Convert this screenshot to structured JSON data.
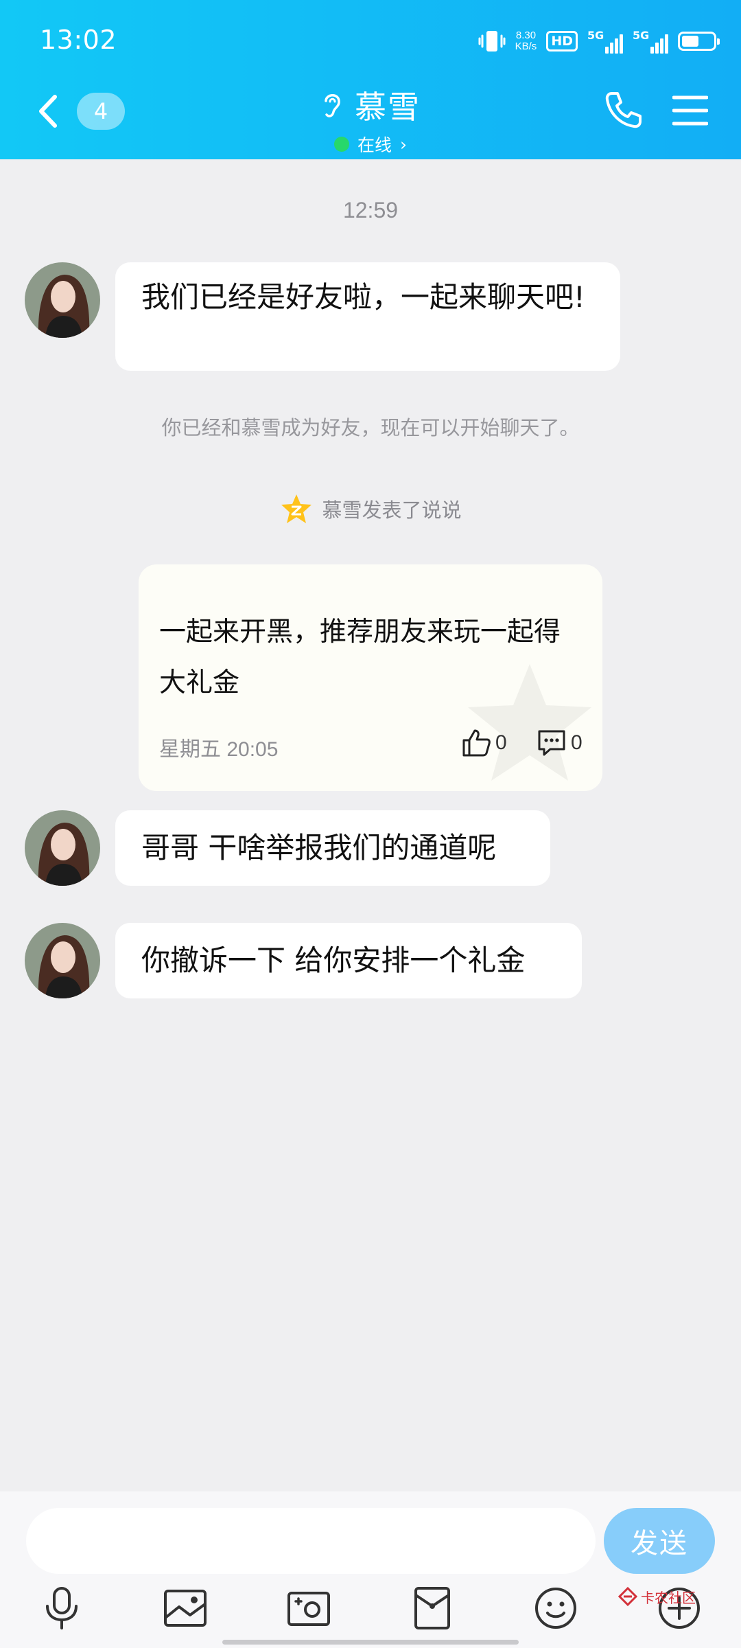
{
  "status_bar": {
    "time": "13:02",
    "speed_value": "8.30",
    "speed_unit": "KB/s",
    "hd_label": "HD",
    "sim1_net": "5G",
    "sim2_net": "5G",
    "battery_level": 0.55
  },
  "header": {
    "unread_count": "4",
    "contact_name": "慕雪",
    "status": "在线",
    "status_arrow": "›"
  },
  "chat": {
    "timestamp": "12:59",
    "messages": [
      {
        "type": "incoming",
        "text": "我们已经是好友啦，一起来聊天吧!"
      },
      {
        "type": "system",
        "text": "你已经和慕雪成为好友，现在可以开始聊天了。"
      },
      {
        "type": "moment_notice",
        "text": "慕雪发表了说说"
      },
      {
        "type": "incoming",
        "text": "哥哥 干啥举报我们的通道呢"
      },
      {
        "type": "incoming",
        "text": "你撤诉一下 给你安排一个礼金"
      }
    ],
    "moment": {
      "text": "一起来开黑，推荐朋友来玩一起得大礼金",
      "date": "星期五 20:05",
      "likes": "0",
      "comments": "0"
    }
  },
  "input": {
    "placeholder": "",
    "value": "",
    "send_label": "发送"
  },
  "toolbar": {
    "icons": [
      "microphone-icon",
      "picture-icon",
      "camera-icon",
      "red-packet-icon",
      "emoji-icon",
      "plus-icon"
    ]
  },
  "watermark": {
    "text": "卡农社区"
  },
  "colors": {
    "header_start": "#12c8f6",
    "header_end": "#12aef5",
    "online": "#27d86a",
    "send_button": "#87cdfa",
    "background": "#efeff1"
  }
}
